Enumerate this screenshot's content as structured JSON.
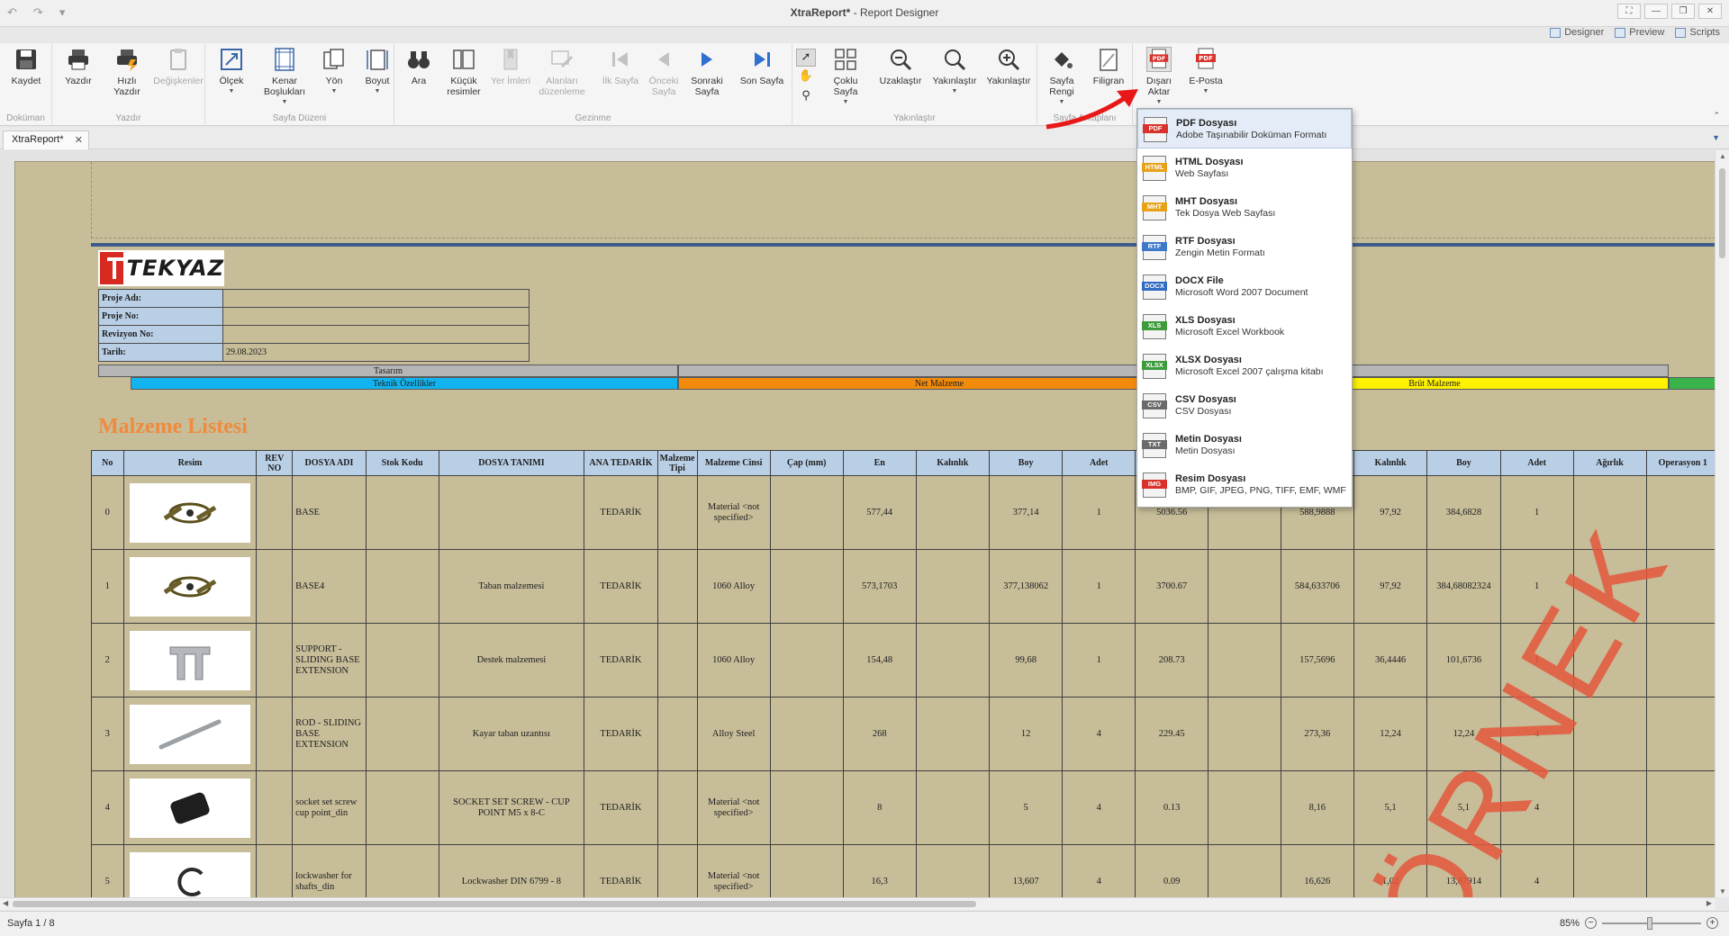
{
  "window": {
    "title_app": "XtraReport*",
    "title_rest": " - Report Designer",
    "view_switch": [
      "Designer",
      "Preview",
      "Scripts"
    ]
  },
  "ribbon": {
    "groups": [
      {
        "label": "Doküman",
        "buttons": [
          {
            "label": "Kaydet"
          }
        ]
      },
      {
        "label": "Yazdır",
        "buttons": [
          {
            "label": "Yazdır"
          },
          {
            "label": "Hızlı Yazdır"
          },
          {
            "label": "Değişkenler"
          }
        ]
      },
      {
        "label": "Sayfa Düzeni",
        "buttons": [
          {
            "label": "Ölçek"
          },
          {
            "label": "Kenar Boşlukları"
          },
          {
            "label": "Yön"
          },
          {
            "label": "Boyut"
          }
        ]
      },
      {
        "label": "Gezinme",
        "buttons": [
          {
            "label": "Ara"
          },
          {
            "label": "Küçük resimler"
          },
          {
            "label": "Yer İmleri"
          },
          {
            "label": "Alanları düzenleme"
          },
          {
            "label": "İlk Sayfa"
          },
          {
            "label": "Önceki Sayfa"
          },
          {
            "label": "Sonraki Sayfa"
          },
          {
            "label": "Son Sayfa"
          }
        ]
      },
      {
        "label": "Yakınlaştır",
        "buttons": [
          {
            "label": "Çoklu Sayfa"
          },
          {
            "label": "Uzaklaştır"
          },
          {
            "label": "Yakınlaştır"
          },
          {
            "label": "Yakınlaştır"
          }
        ]
      },
      {
        "label": "Sayfa Arkaplanı",
        "buttons": [
          {
            "label": "Sayfa Rengi"
          },
          {
            "label": "Filigran"
          }
        ]
      },
      {
        "label": "",
        "buttons": [
          {
            "label": "Dışarı Aktar"
          },
          {
            "label": "E-Posta"
          }
        ]
      }
    ]
  },
  "tab": {
    "label": "XtraReport*",
    "close": "✕"
  },
  "report": {
    "logo_text": "TEKYAZ",
    "meta": [
      {
        "key": "Proje Adı:",
        "value": ""
      },
      {
        "key": "Proje No:",
        "value": ""
      },
      {
        "key": "Revizyon No:",
        "value": ""
      },
      {
        "key": "Tarih:",
        "value": "29.08.2023"
      }
    ],
    "cat_tasarim": "Tasarım",
    "cat_teknik": "Teknik Özellikler",
    "cat_net": "Net Malzeme",
    "cat_brut": "Brüt Malzeme",
    "section_title": "Malzeme Listesi",
    "columns": [
      "No",
      "Resim",
      "REV NO",
      "DOSYA ADI",
      "Stok Kodu",
      "DOSYA TANIMI",
      "ANA TEDARİK",
      "Malzeme Tipi",
      "Malzeme Cinsi",
      "Çap (mm)",
      "En",
      "Kalınlık",
      "Boy",
      "Adet",
      "",
      "",
      "En",
      "Kalınlık",
      "Boy",
      "Adet",
      "Ağırlık",
      "Operasyon 1"
    ],
    "rows": [
      [
        "0",
        "",
        "",
        "BASE",
        "",
        "",
        "TEDARİK",
        "",
        "Material <not specified>",
        "",
        "577,44",
        "",
        "377,14",
        "1",
        "5036.56",
        "",
        "588,9888",
        "97,92",
        "384,6828",
        "1",
        "",
        ""
      ],
      [
        "1",
        "",
        "",
        "BASE4",
        "",
        "Taban malzemesi",
        "TEDARİK",
        "",
        "1060 Alloy",
        "",
        "573,1703",
        "",
        "377,138062",
        "1",
        "3700.67",
        "",
        "584,633706",
        "97,92",
        "384,68082324",
        "1",
        "",
        ""
      ],
      [
        "2",
        "",
        "",
        "SUPPORT - SLIDING BASE EXTENSION",
        "",
        "Destek malzemesi",
        "TEDARİK",
        "",
        "1060 Alloy",
        "",
        "154,48",
        "",
        "99,68",
        "1",
        "208.73",
        "",
        "157,5696",
        "36,4446",
        "101,6736",
        "1",
        "",
        ""
      ],
      [
        "3",
        "",
        "",
        "ROD - SLIDING BASE EXTENSION",
        "",
        "Kayar taban uzantısı",
        "TEDARİK",
        "",
        "Alloy Steel",
        "",
        "268",
        "",
        "12",
        "4",
        "229.45",
        "",
        "273,36",
        "12,24",
        "12,24",
        "4",
        "",
        ""
      ],
      [
        "4",
        "",
        "",
        "socket set screw cup point_din",
        "",
        "SOCKET SET SCREW - CUP POINT M5 x 8-C",
        "TEDARİK",
        "",
        "Material <not specified>",
        "",
        "8",
        "",
        "5",
        "4",
        "0.13",
        "",
        "8,16",
        "5,1",
        "5,1",
        "4",
        "",
        ""
      ],
      [
        "5",
        "",
        "",
        "lockwasher for shafts_din",
        "",
        "Lockwasher DIN 6799 - 8",
        "TEDARİK",
        "",
        "Material <not specified>",
        "",
        "16,3",
        "",
        "13,607",
        "4",
        "0.09",
        "",
        "16,626",
        "1,02",
        "13,87914",
        "4",
        "",
        ""
      ]
    ],
    "watermark": "ÖRNEK"
  },
  "export_menu": [
    {
      "tag": "PDF",
      "color": "#d9322b",
      "title": "PDF Dosyası",
      "sub": "Adobe Taşınabilir Doküman Formatı"
    },
    {
      "tag": "HTML",
      "color": "#e8a21a",
      "title": "HTML Dosyası",
      "sub": "Web Sayfası"
    },
    {
      "tag": "MHT",
      "color": "#e8a21a",
      "title": "MHT Dosyası",
      "sub": "Tek Dosya Web Sayfası"
    },
    {
      "tag": "RTF",
      "color": "#3d78c9",
      "title": "RTF Dosyası",
      "sub": "Zengin Metin Formatı"
    },
    {
      "tag": "DOCX",
      "color": "#2f6bc4",
      "title": "DOCX File",
      "sub": "Microsoft Word 2007 Document"
    },
    {
      "tag": "XLS",
      "color": "#3e9b3b",
      "title": "XLS Dosyası",
      "sub": "Microsoft Excel Workbook"
    },
    {
      "tag": "XLSX",
      "color": "#3e9b3b",
      "title": "XLSX Dosyası",
      "sub": "Microsoft Excel 2007 çalışma kitabı"
    },
    {
      "tag": "CSV",
      "color": "#6b6b6b",
      "title": "CSV Dosyası",
      "sub": "CSV Dosyası"
    },
    {
      "tag": "TXT",
      "color": "#6b6b6b",
      "title": "Metin Dosyası",
      "sub": "Metin Dosyası"
    },
    {
      "tag": "IMG",
      "color": "#d9322b",
      "title": "Resim Dosyası",
      "sub": "BMP, GIF, JPEG, PNG, TIFF, EMF, WMF"
    }
  ],
  "status": {
    "page": "Sayfa 1 / 8",
    "zoom": "85%"
  }
}
